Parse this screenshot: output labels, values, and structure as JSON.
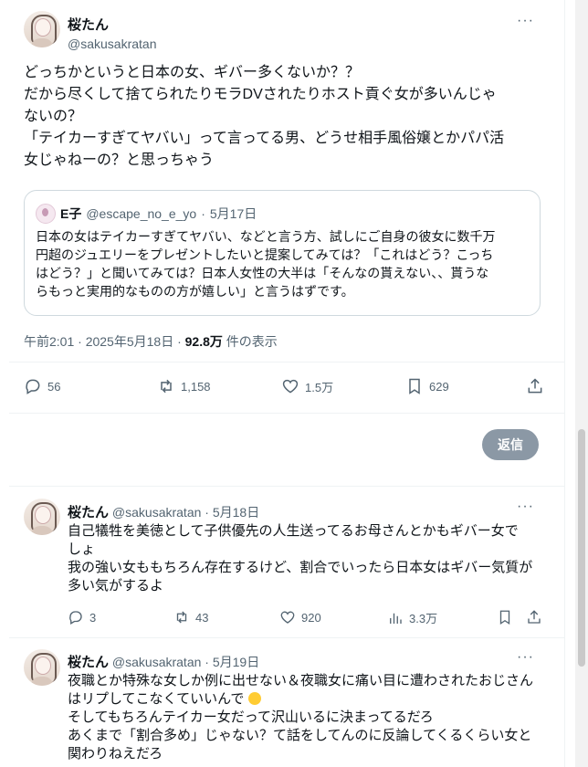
{
  "tweet": {
    "display_name": "桜たん",
    "handle": "@sakusakratan",
    "lines": [
      "どっちかというと日本の女、ギバー多くないか？？",
      "だから尽くして捨てられたりモラDVされたりホスト貢ぐ女が多いんじゃ",
      "ないの？",
      "「テイカーすぎてヤバい」って言ってる男、どうせ相手風俗嬢とかパパ活",
      "女じゃねーの？と思っちゃう"
    ],
    "quote": {
      "name": "E子",
      "handle": "@escape_no_e_yo",
      "date": "5月17日",
      "lines": [
        "日本の女はテイカーすぎてヤバい、などと言う方、試しにご自身の彼女に数千万",
        "円超のジュエリーをプレゼントしたいと提案してみては？「これはどう？こっち",
        "はどう？」と聞いてみては？日本人女性の大半は「そんなの貰えない、、貰うな",
        "らもっと実用的なものの方が嬉しい」と言うはずです。"
      ]
    },
    "time": "午前2:01 · 2025年5月18日 · ",
    "views": "92.8万",
    "views_label": " 件の表示",
    "replies": "56",
    "retweets": "1,158",
    "likes": "1.5万",
    "bookmarks": "629",
    "reply_button": "返信"
  },
  "replies": [
    {
      "display_name": "桜たん",
      "handle": "@sakusakratan",
      "date": "5月18日",
      "lines": [
        "自己犠牲を美徳として子供優先の人生送ってるお母さんとかもギバー女で",
        "しょ",
        "我の強い女ももちろん存在するけど、割合でいったら日本女はギバー気質が",
        "多い気がするよ"
      ],
      "replies": "3",
      "retweets": "43",
      "likes": "920",
      "views": "3.3万"
    },
    {
      "display_name": "桜たん",
      "handle": "@sakusakratan",
      "date": "5月19日",
      "lines": [
        "夜職とか特殊な女しか例に出せない＆夜職女に痛い目に遭わされたおじさん",
        "はリプしてこなくていいんで",
        "そしてもちろんテイカー女だって沢山いるに決まってるだろ",
        "あくまで「割合多め」じゃない？て話をしてんのに反論してくるくらい女と",
        "関わりねえだろ"
      ]
    }
  ],
  "separator": " · ",
  "more_label": "···"
}
